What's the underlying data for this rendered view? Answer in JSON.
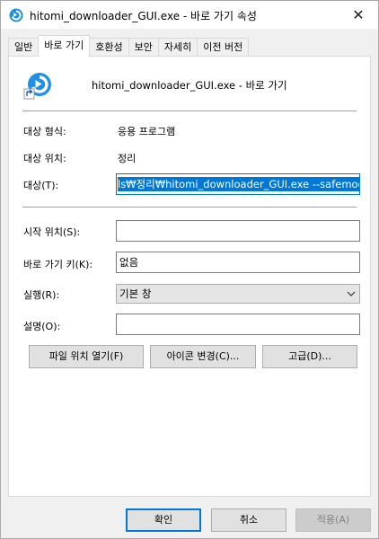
{
  "window": {
    "title": "hitomi_downloader_GUI.exe - 바로 가기 속성",
    "close_glyph": "✕"
  },
  "tabs": [
    {
      "label": "일반"
    },
    {
      "label": "바로 가기"
    },
    {
      "label": "호환성"
    },
    {
      "label": "보안"
    },
    {
      "label": "자세히"
    },
    {
      "label": "이전 버전"
    }
  ],
  "shortcut": {
    "name": "hitomi_downloader_GUI.exe - 바로 가기",
    "target_type_label": "대상 형식:",
    "target_type_value": "응용 프로그램",
    "target_location_label": "대상 위치:",
    "target_location_value": "정리",
    "target_label": "대상(T):",
    "target_value": "ls₩정리₩hitomi_downloader_GUI.exe --safemode",
    "start_in_label": "시작 위치(S):",
    "start_in_value": "",
    "hotkey_label": "바로 가기 키(K):",
    "hotkey_value": "없음",
    "run_label": "실행(R):",
    "run_value": "기본 창",
    "comment_label": "설명(O):",
    "comment_value": ""
  },
  "actions": {
    "open_location": "파일 위치 열기(F)",
    "change_icon": "아이콘 변경(C)...",
    "advanced": "고급(D)..."
  },
  "footer": {
    "ok": "확인",
    "cancel": "취소",
    "apply": "적용(A)"
  },
  "colors": {
    "accent": "#0078d7",
    "icon_blue": "#1e90e6"
  }
}
